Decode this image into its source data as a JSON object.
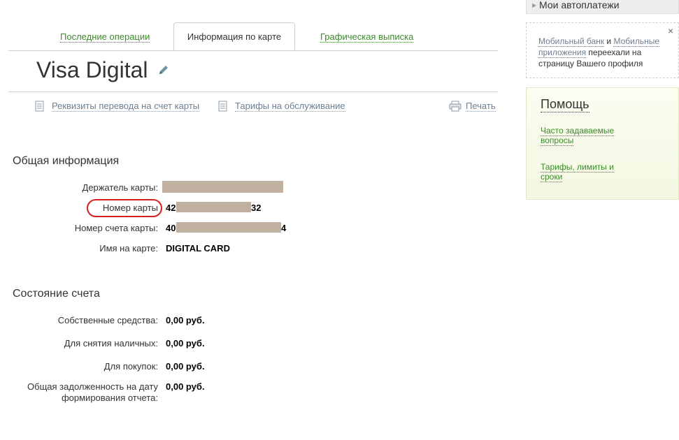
{
  "tabs": {
    "recent": "Последние операции",
    "info": "Информация по карте",
    "graphic": "Графическая выписка"
  },
  "card": {
    "title": "Visa Digital"
  },
  "actions": {
    "requisites": "Реквизиты перевода на счет карты",
    "tariffs": "Тарифы на обслуживание",
    "print": "Печать"
  },
  "general": {
    "title": "Общая информация",
    "holder_label": "Держатель карты:",
    "card_number_label": "Номер карты",
    "card_number_prefix": "42",
    "card_number_suffix": "32",
    "account_label": "Номер счета карты:",
    "account_prefix": "40",
    "account_suffix": "4",
    "name_label": "Имя на карте:",
    "name_value": "DIGITAL CARD"
  },
  "account_state": {
    "title": "Состояние счета",
    "own_label": "Собственные средства:",
    "own_value": "0,00 руб.",
    "cash_label": "Для снятия наличных:",
    "cash_value": "0,00 руб.",
    "purchase_label": "Для покупок:",
    "purchase_value": "0,00 руб.",
    "debt_label_1": "Общая задолженность на дату",
    "debt_label_2": "формирования отчета:",
    "debt_value": "0,00 руб."
  },
  "sidebar": {
    "autopay": "Мои автоплатежи",
    "notice_link1": "Мобильный банк",
    "notice_and": " и ",
    "notice_link2": "Мобильные приложения",
    "notice_rest": " переехали на страницу Вашего профиля",
    "close": "×",
    "help_title": "Помощь",
    "faq": "Часто задаваемые вопросы",
    "limits": "Тарифы, лимиты и сроки"
  },
  "colors": {
    "link_green": "#3a8a2a",
    "redaction": "#c0b0a2",
    "highlight": "#d42020"
  }
}
